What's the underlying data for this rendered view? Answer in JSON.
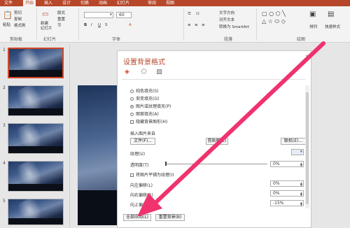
{
  "ribbon_tabs": [
    "文件",
    "开始",
    "插入",
    "设计",
    "切换",
    "动画",
    "幻灯片",
    "审阅",
    "视图"
  ],
  "ribbon": {
    "clipboard": {
      "paste": "粘贴",
      "cut": "剪切",
      "copy": "复制",
      "format_painter": "格式刷",
      "label": "剪贴板"
    },
    "slides": {
      "new_slide": "新建\n幻灯片",
      "layout": "版式",
      "reset": "重置",
      "section": "节",
      "label": "幻灯片"
    },
    "font": {
      "size": "60",
      "label": "字体"
    },
    "paragraph": {
      "text_direction": "文字方向",
      "align_text": "对齐文本",
      "smartart": "转换为 SmartArt",
      "label": "段落"
    },
    "drawing": {
      "arrange": "排列",
      "quick_styles": "快速样式",
      "label": "绘图"
    }
  },
  "thumbnails": [
    "1",
    "2",
    "3",
    "4",
    "5"
  ],
  "format_pane": {
    "title": "设置背景格式",
    "fill_options": [
      {
        "label": "纯色填充(S)",
        "selected": false
      },
      {
        "label": "渐变填充(G)",
        "selected": false
      },
      {
        "label": "图片或纹理填充(P)",
        "selected": true
      },
      {
        "label": "图案填充(A)",
        "selected": false
      }
    ],
    "hide_graphics": "隐藏背景图形(H)",
    "insert_from": "插入图片来自",
    "file_button": "文件(F)...",
    "clipboard_button": "剪贴板(C)",
    "online_button": "联机(E)...",
    "texture_label": "纹理(U)",
    "transparency_label": "透明度(T)",
    "transparency_value": "0%",
    "tile_label": "将图片平铺为纹理(I)",
    "offset_left_label": "向左偏移(L)",
    "offset_left_value": "0%",
    "offset_right_label": "向右偏移(R)",
    "offset_right_value": "0%",
    "offset_top_label": "向上偏移(O)",
    "offset_top_value": "-15%",
    "apply_all": "全部应用(L)",
    "reset_bg": "重置背景(B)"
  },
  "colors": {
    "accent": "#b7472a",
    "arrow": "#f0326e"
  }
}
